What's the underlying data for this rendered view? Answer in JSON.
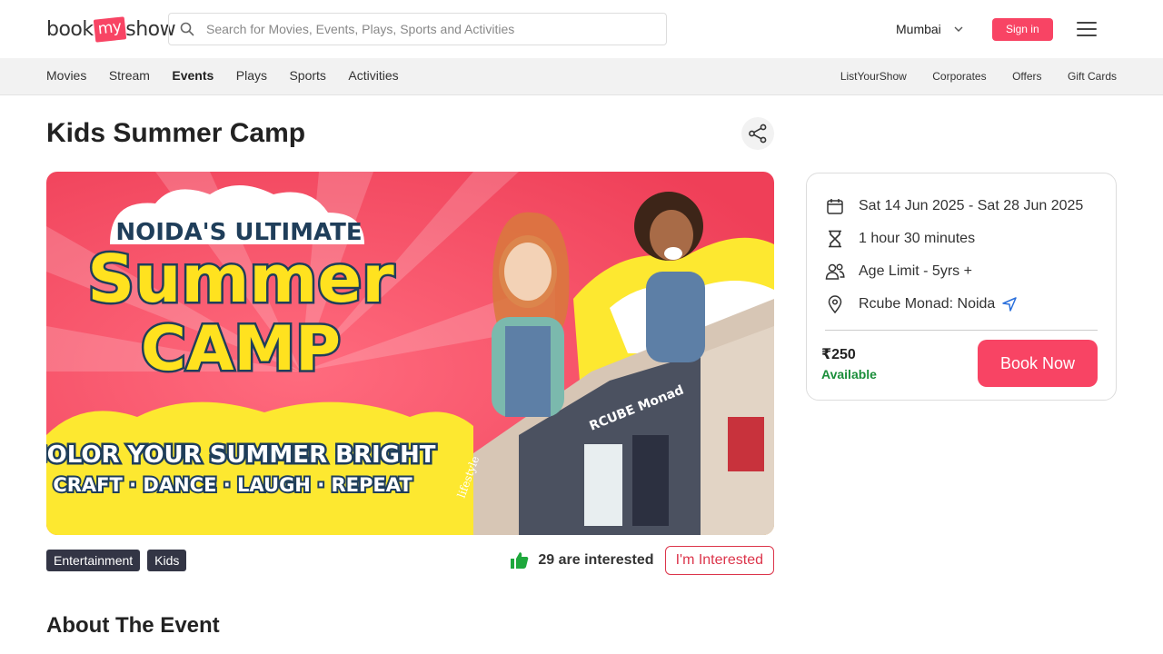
{
  "header": {
    "logo_pre": "book",
    "logo_mid": "my",
    "logo_post": "show",
    "search_placeholder": "Search for Movies, Events, Plays, Sports and Activities",
    "city": "Mumbai",
    "signin_label": "Sign in"
  },
  "subnav": {
    "left": [
      "Movies",
      "Stream",
      "Events",
      "Plays",
      "Sports",
      "Activities"
    ],
    "active": "Events",
    "right": [
      "ListYourShow",
      "Corporates",
      "Offers",
      "Gift Cards"
    ]
  },
  "event": {
    "title": "Kids Summer Camp",
    "banner": {
      "line1": "NOIDA'S ULTIMATE",
      "line2": "Summer",
      "line3": "CAMP",
      "line4": "COLOR YOUR SUMMER BRIGHT",
      "line5": "CRAFT · DANCE · LAUGH · REPEAT",
      "building_sign": "RCUBE Monad",
      "store_sign": "lifestyle"
    },
    "tags": [
      "Entertainment",
      "Kids"
    ],
    "interested_count": "29 are interested",
    "interested_button": "I'm Interested",
    "about_heading": "About The Event"
  },
  "details": {
    "dates": "Sat 14 Jun 2025 - Sat 28 Jun 2025",
    "duration": "1 hour 30 minutes",
    "age": "Age Limit - 5yrs +",
    "venue": "Rcube Monad: Noida",
    "price": "₹250",
    "availability": "Available",
    "book_label": "Book Now"
  },
  "colors": {
    "brand": "#f84464",
    "available": "#1a8e3a",
    "tag_bg": "#333545"
  }
}
